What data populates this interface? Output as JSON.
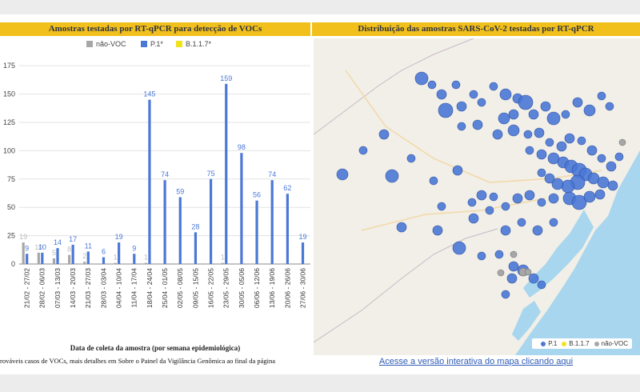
{
  "left_panel": {
    "title": "Amostras testadas por RT-qPCR para detecção de VOCs",
    "x_axis_title": "Data de coleta da amostra (por semana epidemiológica)",
    "footnote": "rováveis casos de VOCs, mais detalhes em Sobre o Painel da Vigilância Genômica ao final da página"
  },
  "right_panel": {
    "title": "Distribuição das amostras SARS-CoV-2 testadas por RT-qPCR",
    "link": "Acesse a versão interativa do mapa clicando aqui",
    "legend": [
      "P.1",
      "B.1.1.7",
      "não-VOC"
    ]
  },
  "colors": {
    "nao_voc": "#a7a7a7",
    "p1": "#4a78d6",
    "b117": "#f2e21c",
    "header": "#f2c01c",
    "sea": "#a7d6ee",
    "land": "#f1efe7"
  },
  "chart_data": {
    "type": "bar",
    "categories": [
      "21/02 - 27/02",
      "28/02 - 06/03",
      "07/03 - 13/03",
      "14/03 - 20/03",
      "21/03 - 27/03",
      "28/03 - 03/04",
      "04/04 - 10/04",
      "11/04 - 17/04",
      "18/04 - 24/04",
      "25/04 - 01/05",
      "02/05 - 08/05",
      "09/05 - 15/05",
      "16/05 - 22/05",
      "23/05 - 29/05",
      "30/05 - 05/06",
      "06/06 - 12/06",
      "13/06 - 19/06",
      "20/06 - 26/06",
      "27/06 - 30/06"
    ],
    "series": [
      {
        "name": "não-VOC",
        "values": [
          19,
          10,
          5,
          8,
          2,
          0,
          1,
          0,
          1,
          0,
          0,
          0,
          0,
          1,
          0,
          0,
          0,
          0,
          0
        ],
        "labels": [
          "19",
          "10",
          "5",
          "8",
          "2",
          "",
          "1",
          "",
          "1",
          "",
          "",
          "",
          "",
          "1",
          "",
          "",
          "",
          "",
          ""
        ]
      },
      {
        "name": "P.1*",
        "values": [
          9,
          10,
          14,
          17,
          11,
          6,
          19,
          9,
          145,
          74,
          59,
          28,
          75,
          159,
          98,
          56,
          74,
          62,
          19
        ],
        "labels": [
          "9",
          "10",
          "14",
          "17",
          "11",
          "6",
          "19",
          "9",
          "145",
          "74",
          "59",
          "28",
          "75",
          "159",
          "98",
          "56",
          "74",
          "62",
          "19"
        ]
      },
      {
        "name": "B.1.1.7*",
        "values": [
          0,
          0,
          0,
          0,
          0,
          0,
          0,
          0,
          0,
          0,
          0,
          0,
          0,
          0,
          0,
          0,
          0,
          0,
          0
        ],
        "labels": [
          "",
          "",
          "",
          "",
          "",
          "",
          "",
          "",
          "",
          "",
          "",
          "",
          "",
          "",
          "",
          "",
          "",
          "",
          ""
        ]
      }
    ],
    "yticks": [
      "0",
      "25",
      "50",
      "75",
      "100",
      "125",
      "150",
      "175"
    ],
    "ylim": [
      0,
      185
    ],
    "legend_position": "top"
  }
}
